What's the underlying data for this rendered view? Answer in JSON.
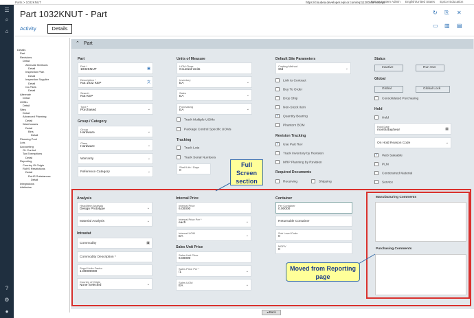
{
  "topbar": {
    "breadcrumb": "Parts  >  1032KNUT",
    "url": "https://cloudea.developer.epicor.com/erp11200/demodeya",
    "user": "Epicor System Admin",
    "locale": "English/United States",
    "company": "Epicor Education"
  },
  "header": {
    "title": "Part 1032KNUT - Part",
    "tab_activity": "Activity",
    "tab_details": "Details"
  },
  "tree": [
    "Details",
    "Part",
    "Revisions",
    "Detail",
    "Alternate Methods",
    "Detail",
    "Inspection Plan",
    "Detail",
    "Inspection Supplier",
    "Detail",
    "Co-Parts",
    "Detail",
    "Alternate",
    "Detail",
    "UOMs",
    "Detail",
    "Sites",
    "Detail",
    "Advanced Planning",
    "Detail",
    "Warehouses",
    "Detail",
    "Bins",
    "Detail",
    "Planning Pool",
    "Lots",
    "Accounting",
    "GL Control",
    "Tax Exemptions",
    "Detail",
    "Reporting",
    "Country Of Origin",
    "RoHS Restrictions",
    "Detail",
    "RoHS Substances",
    "Detail",
    "Integrations",
    "Attributes"
  ],
  "section": {
    "title": "Part"
  },
  "part": {
    "heading": "Part",
    "part_label": "Part *",
    "part_value": "1032KNUT",
    "desc_label": "Description *",
    "desc_value": "Nut 1032 KEP",
    "search_label": "Search",
    "search_value": "Nut KEP",
    "type_label": "Type *",
    "type_value": "Purchased"
  },
  "group": {
    "heading": "Group / Category",
    "group_label": "Group",
    "group_value": "Hardware",
    "class_label": "Class",
    "class_value": "Hardware",
    "warranty": "Warranty",
    "refcat": "Reference Category"
  },
  "uom": {
    "heading": "Units of Measure",
    "class_label": "UOM Class",
    "class_value": "Counted Units",
    "inv_label": "Inventory",
    "inv_value": "EA",
    "sales_label": "Sales",
    "sales_value": "EA",
    "purch_label": "Purchasing",
    "purch_value": "EA",
    "track_multi": "Track Multiple UOMs",
    "pkg_ctrl": "Package Control Specific UOMs"
  },
  "tracking": {
    "heading": "Tracking",
    "lots": "Track Lots",
    "serial": "Track Serial Numbers",
    "shelf_label": "Shelf Life / Days",
    "shelf_value": "0"
  },
  "default_site": {
    "heading": "Default Site Parameters",
    "costing_label": "Costing Method",
    "costing_value": "Std",
    "link": "Link to Contract",
    "buy": "Buy To Order",
    "drop": "Drop Ship",
    "nonstock": "Non-Stock Item",
    "qty": "Quantity Bearing",
    "phantom": "Phantom BOM"
  },
  "revision": {
    "heading": "Revision Tracking",
    "use": "Use Part Rev",
    "inv": "Track Inventory by Revision",
    "mrp": "MRP Planning by Revision"
  },
  "required": {
    "heading": "Required Documents",
    "receiving": "Receiving",
    "shipping": "Shipping"
  },
  "status": {
    "heading": "Status",
    "inactive": "Inactive",
    "runout": "Run Out"
  },
  "global": {
    "heading": "Global",
    "global": "Global",
    "lock": "Global Lock",
    "consolidated": "Consolidated Purchasing"
  },
  "hold": {
    "heading": "Hold",
    "hold": "Hold",
    "date_label": "Hold Date",
    "date_value": "month/day/year",
    "reason": "On Hold Reason Code"
  },
  "misc": {
    "web": "Web Saleable",
    "plm": "PLM",
    "constrained": "Constrained Material",
    "service": "Service"
  },
  "analysis": {
    "heading": "Analysis",
    "head_label": "Head/Item Analysis",
    "head_value": "Design Prototype",
    "material": "Material Analysis"
  },
  "intrastat": {
    "heading": "Intrastat",
    "commodity": "Commodity",
    "commodity_desc": "Commodity Description *",
    "supp_label": "Suppl Units Factor",
    "supp_value": "1.00000000",
    "country_label": "Country of Origin",
    "country_value": "None Selected"
  },
  "internal_price": {
    "heading": "Internal Price",
    "price_label": "Internal Price",
    "price_value": "6.00000",
    "per_label": "Internal Price Per *",
    "per_value": "each",
    "uom_label": "Internal UOM",
    "uom_value": "EA"
  },
  "sales_unit": {
    "heading": "Sales Unit Price",
    "price_label": "Sales Unit Price",
    "price_value": "6.00000",
    "per_label": "Sales Price Per *",
    "per_value": "/1",
    "uom_label": "Sales UOM",
    "uom_value": "EA"
  },
  "container": {
    "heading": "Container",
    "per_label": "Per Container",
    "per_value": "0.00000",
    "returnable": "Returnable Container",
    "sub_label": "Sub Level Code",
    "sub_value": "0",
    "mdpv_label": "MDPV",
    "mdpv_value": "0"
  },
  "comments": {
    "mfg": "Manufacturing Comments",
    "purch": "Purchasing Comments"
  },
  "callouts": {
    "full": "Full Screen section",
    "moved": "Moved from Reporting page"
  },
  "footer": {
    "back": "Back"
  }
}
